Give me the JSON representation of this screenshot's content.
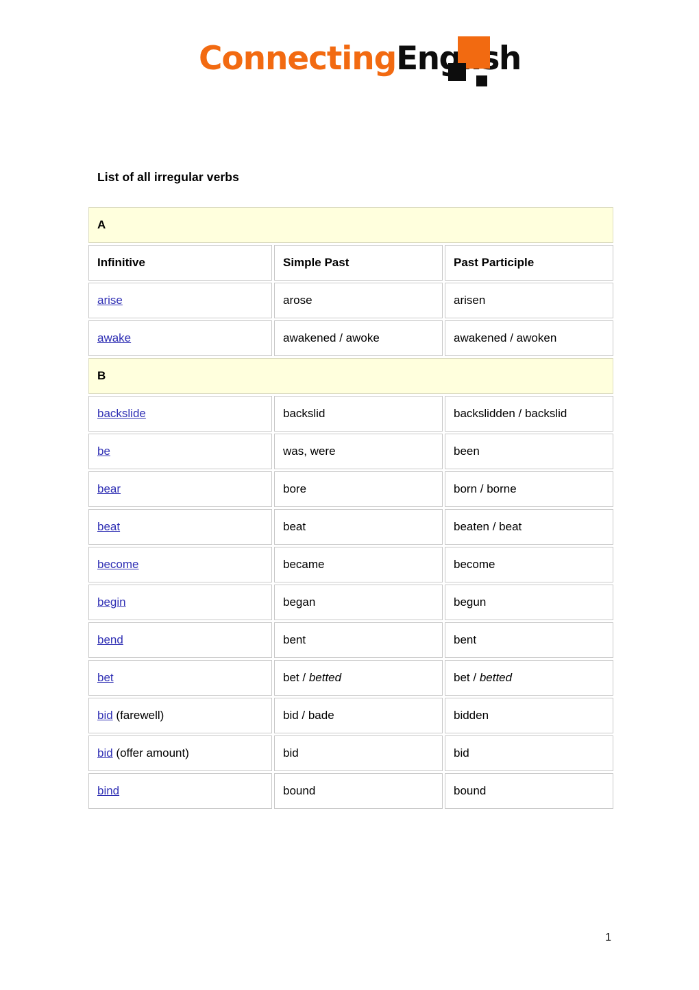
{
  "logo": {
    "text_primary": "Connecting",
    "text_secondary": "English",
    "color_orange": "#f26a11",
    "color_black": "#0d0d0d"
  },
  "document": {
    "title": "List of all irregular verbs",
    "page_number": "1"
  },
  "table": {
    "columns": [
      "Infinitive",
      "Simple Past",
      "Past Participle"
    ],
    "section_a_label": "A",
    "section_b_label": "B",
    "link_color": "#2f2fb4",
    "section_bg": "#ffffdd",
    "rows_a": [
      {
        "infinitive_link": "arise",
        "infinitive_note": "",
        "simple_past": "arose",
        "simple_past_italic": "",
        "past_participle": "arisen",
        "past_participle_italic": ""
      },
      {
        "infinitive_link": "awake",
        "infinitive_note": "",
        "simple_past": "awakened / awoke",
        "simple_past_italic": "",
        "past_participle": "awakened / awoken",
        "past_participle_italic": ""
      }
    ],
    "rows_b": [
      {
        "infinitive_link": "backslide",
        "infinitive_note": "",
        "simple_past": "backslid",
        "simple_past_italic": "",
        "past_participle": "backslidden / backslid",
        "past_participle_italic": ""
      },
      {
        "infinitive_link": "be",
        "infinitive_note": "",
        "simple_past": "was, were",
        "simple_past_italic": "",
        "past_participle": "been",
        "past_participle_italic": ""
      },
      {
        "infinitive_link": "bear",
        "infinitive_note": "",
        "simple_past": "bore",
        "simple_past_italic": "",
        "past_participle": "born / borne",
        "past_participle_italic": ""
      },
      {
        "infinitive_link": "beat",
        "infinitive_note": "",
        "simple_past": "beat",
        "simple_past_italic": "",
        "past_participle": "beaten / beat",
        "past_participle_italic": ""
      },
      {
        "infinitive_link": "become",
        "infinitive_note": "",
        "simple_past": "became",
        "simple_past_italic": "",
        "past_participle": "become",
        "past_participle_italic": ""
      },
      {
        "infinitive_link": "begin",
        "infinitive_note": "",
        "simple_past": "began",
        "simple_past_italic": "",
        "past_participle": "begun",
        "past_participle_italic": ""
      },
      {
        "infinitive_link": "bend",
        "infinitive_note": "",
        "simple_past": "bent",
        "simple_past_italic": "",
        "past_participle": "bent",
        "past_participle_italic": ""
      },
      {
        "infinitive_link": "bet",
        "infinitive_note": "",
        "simple_past": "bet / ",
        "simple_past_italic": "betted",
        "past_participle": "bet / ",
        "past_participle_italic": "betted"
      },
      {
        "infinitive_link": "bid",
        "infinitive_note": " (farewell)",
        "simple_past": "bid / bade",
        "simple_past_italic": "",
        "past_participle": "bidden",
        "past_participle_italic": ""
      },
      {
        "infinitive_link": "bid",
        "infinitive_note": " (offer amount)",
        "simple_past": "bid",
        "simple_past_italic": "",
        "past_participle": "bid",
        "past_participle_italic": ""
      },
      {
        "infinitive_link": "bind",
        "infinitive_note": "",
        "simple_past": "bound",
        "simple_past_italic": "",
        "past_participle": "bound",
        "past_participle_italic": ""
      }
    ]
  }
}
